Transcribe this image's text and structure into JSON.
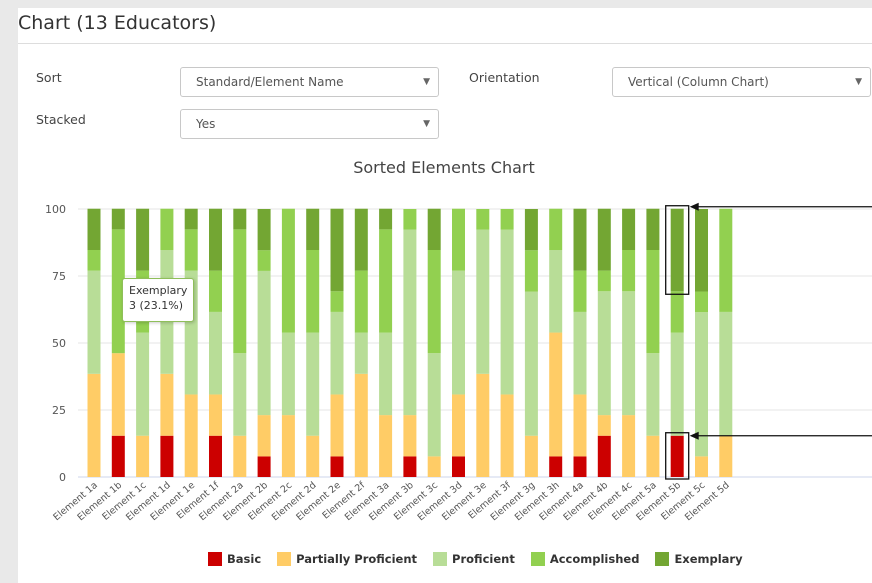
{
  "panel_title": "Chart (13 Educators)",
  "controls": {
    "sort_label": "Sort",
    "sort_value": "Standard/Element Name",
    "orientation_label": "Orientation",
    "orientation_value": "Vertical (Column Chart)",
    "stacked_label": "Stacked",
    "stacked_value": "Yes"
  },
  "tooltip": {
    "line1": "Exemplary",
    "line2": "3 (23.1%)"
  },
  "chart_data": {
    "type": "bar",
    "stacked": true,
    "title": "Sorted Elements Chart",
    "ylim": [
      0,
      100
    ],
    "yticks": [
      0,
      25,
      50,
      75,
      100
    ],
    "grid": true,
    "legend_position": "bottom",
    "categories": [
      "Element 1a",
      "Element 1b",
      "Element 1c",
      "Element 1d",
      "Element 1e",
      "Element 1f",
      "Element 2a",
      "Element 2b",
      "Element 2c",
      "Element 2d",
      "Element 2e",
      "Element 2f",
      "Element 3a",
      "Element 3b",
      "Element 3c",
      "Element 3d",
      "Element 3e",
      "Element 3f",
      "Element 3g",
      "Element 3h",
      "Element 4a",
      "Element 4b",
      "Element 4c",
      "Element 5a",
      "Element 5b",
      "Element 5c",
      "Element 5d"
    ],
    "series": [
      {
        "name": "Basic",
        "color": "#cc0000",
        "values": [
          0,
          15.4,
          0,
          15.4,
          0,
          15.4,
          0,
          7.7,
          0,
          0,
          7.7,
          0,
          0,
          7.7,
          0,
          7.7,
          0,
          0,
          0,
          7.7,
          7.7,
          15.4,
          0,
          0,
          15.4,
          0,
          0
        ]
      },
      {
        "name": "Partially Proficient",
        "color": "#ffcc66",
        "values": [
          38.5,
          30.8,
          15.4,
          23.1,
          30.8,
          15.4,
          15.4,
          15.4,
          23.1,
          15.4,
          23.1,
          38.5,
          23.1,
          15.4,
          7.7,
          23.1,
          38.5,
          30.8,
          15.4,
          46.2,
          23.1,
          7.7,
          23.1,
          15.4,
          0,
          7.7,
          15.4
        ]
      },
      {
        "name": "Proficient",
        "color": "#b8dd97",
        "values": [
          38.5,
          0,
          38.5,
          46.2,
          46.2,
          30.8,
          30.8,
          53.8,
          30.8,
          38.5,
          30.8,
          15.4,
          30.8,
          69.2,
          38.5,
          46.2,
          53.8,
          61.5,
          53.8,
          30.8,
          30.8,
          46.2,
          46.2,
          30.8,
          38.5,
          53.8,
          46.2
        ]
      },
      {
        "name": "Accomplished",
        "color": "#92d050",
        "values": [
          7.7,
          46.2,
          23.1,
          15.4,
          15.4,
          15.4,
          46.2,
          7.7,
          46.2,
          30.8,
          7.7,
          23.1,
          38.5,
          7.7,
          38.5,
          23.1,
          7.7,
          7.7,
          15.4,
          15.4,
          15.4,
          7.7,
          15.4,
          38.5,
          15.4,
          7.7,
          38.5
        ]
      },
      {
        "name": "Exemplary",
        "color": "#73a633",
        "values": [
          15.4,
          7.7,
          23.1,
          0,
          7.7,
          23.1,
          7.7,
          15.4,
          0,
          15.4,
          30.8,
          23.1,
          7.7,
          0,
          15.4,
          0,
          0,
          0,
          15.4,
          0,
          23.1,
          23.1,
          15.4,
          15.4,
          30.8,
          30.8,
          0
        ]
      }
    ]
  }
}
